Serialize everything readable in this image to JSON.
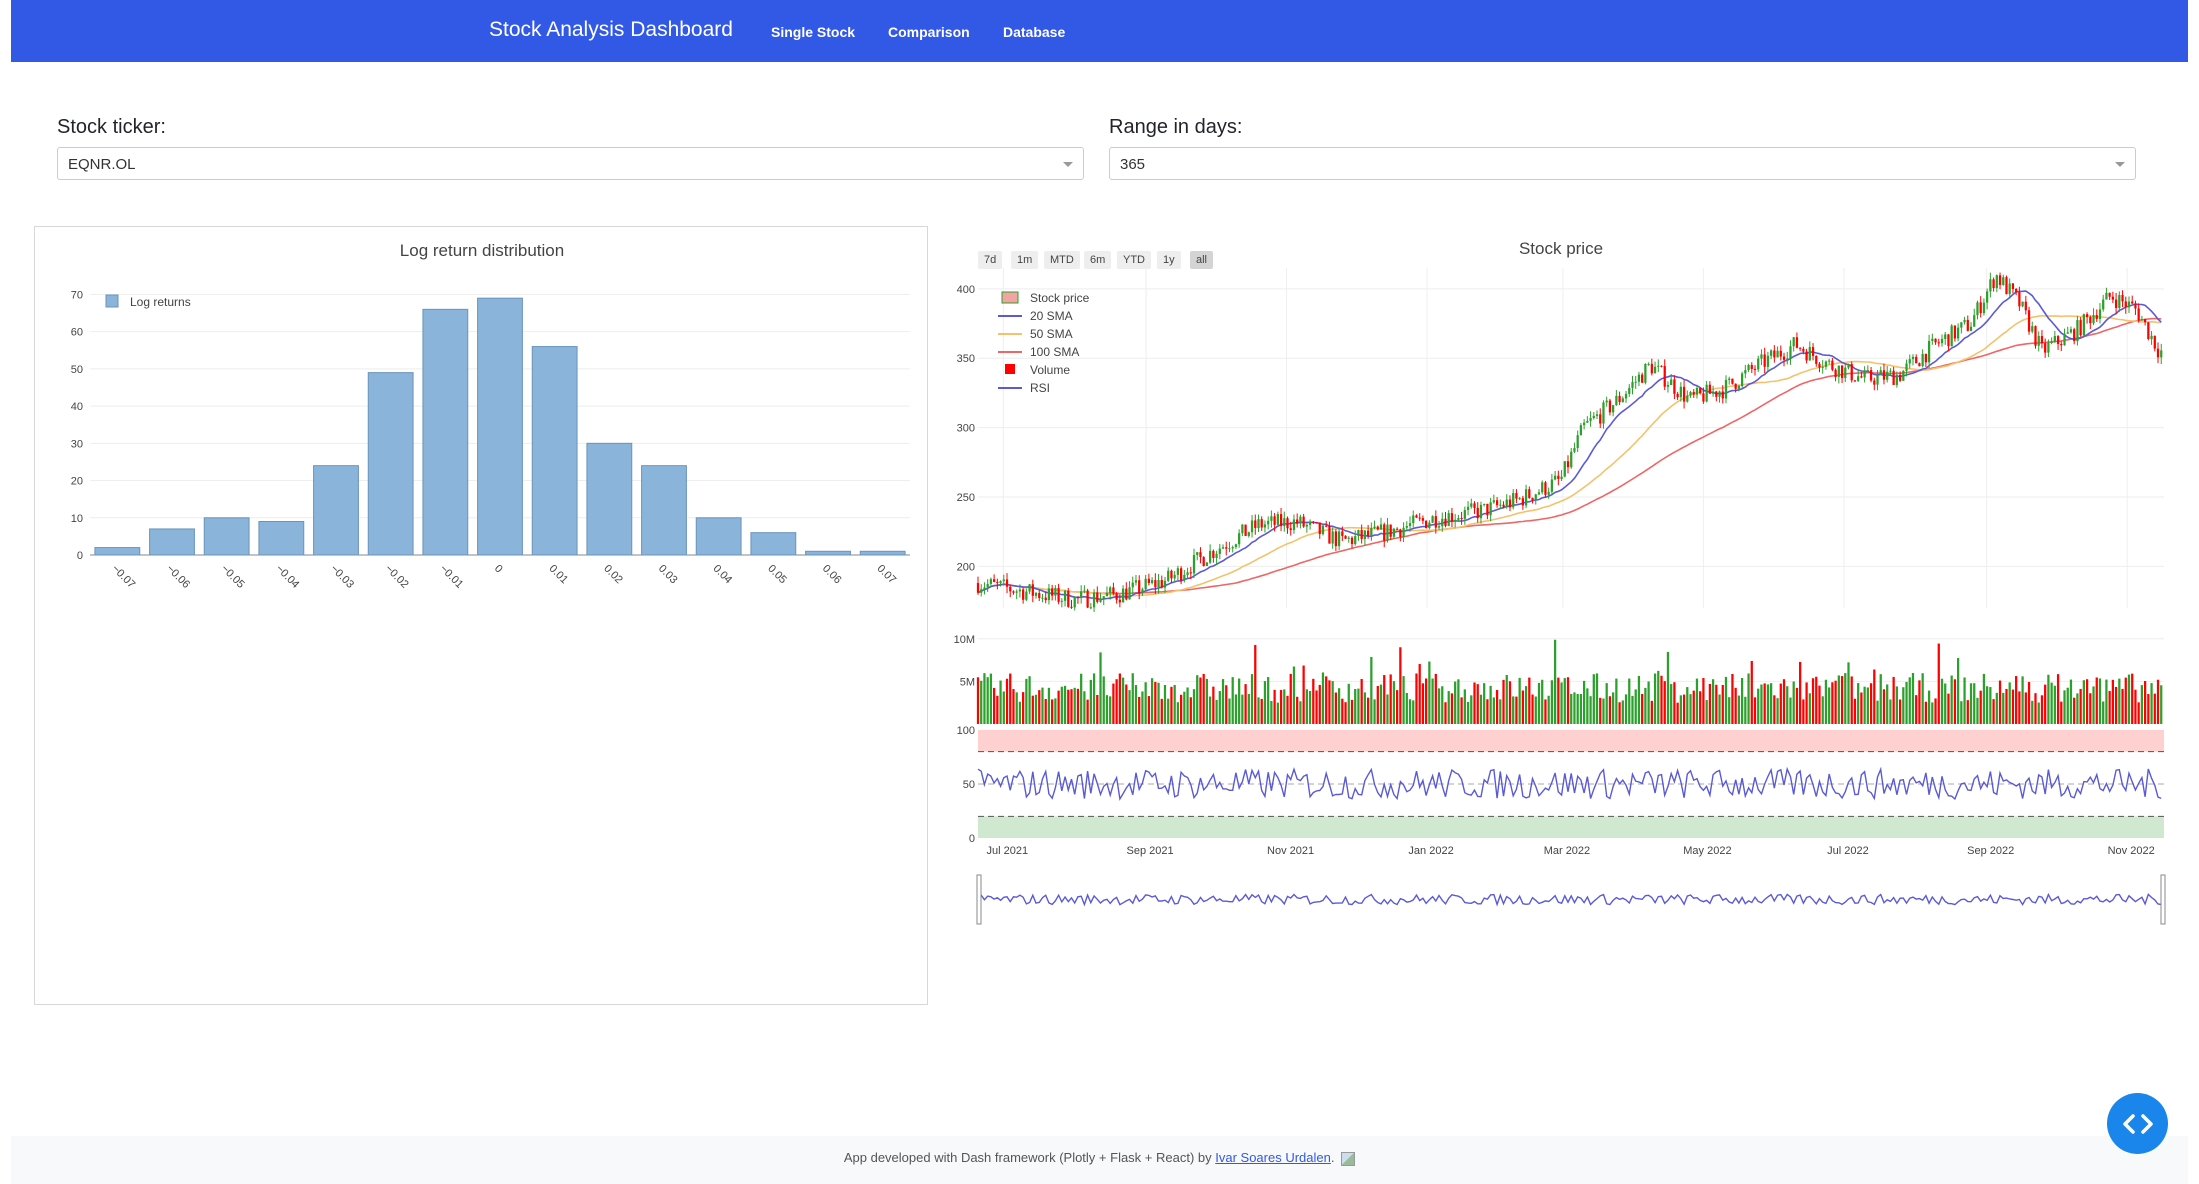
{
  "navbar": {
    "brand": "Stock Analysis Dashboard",
    "links": [
      "Single Stock",
      "Comparison",
      "Database"
    ]
  },
  "controls": {
    "ticker_label": "Stock ticker:",
    "ticker_value": "EQNR.OL",
    "range_label": "Range in days:",
    "range_value": "365"
  },
  "range_selector": [
    "7d",
    "1m",
    "MTD",
    "6m",
    "YTD",
    "1y",
    "all"
  ],
  "range_selector_active": "all",
  "footer": {
    "text_prefix": "App developed with Dash framework (Plotly + Flask + React) by ",
    "author_link": "Ivar Soares Urdalen",
    "text_suffix": "."
  },
  "colors": {
    "navbar": "#3258e6",
    "bar_fill": "#8ab4da",
    "increasing": "#2ca02c",
    "decreasing": "#ff0000",
    "sma20": "#5a5ad6",
    "sma50": "#f5c26b",
    "sma100": "#ee6666",
    "rsi": "#5a5ad6"
  },
  "chart_data": [
    {
      "type": "bar",
      "title": "Log return distribution",
      "legend": [
        "Log returns"
      ],
      "x": [
        -0.07,
        -0.06,
        -0.05,
        -0.04,
        -0.03,
        -0.02,
        -0.01,
        0,
        0.01,
        0.02,
        0.03,
        0.04,
        0.05,
        0.06,
        0.07
      ],
      "x_tick_labels": [
        "−0.07",
        "−0.06",
        "−0.05",
        "−0.04",
        "−0.03",
        "−0.02",
        "−0.01",
        "0",
        "0.01",
        "0.02",
        "0.03",
        "0.04",
        "0.05",
        "0.06",
        "0.07"
      ],
      "values": [
        2,
        7,
        10,
        9,
        24,
        49,
        66,
        69,
        56,
        30,
        24,
        10,
        6,
        1,
        1
      ],
      "y_ticks": [
        0,
        10,
        20,
        30,
        40,
        50,
        60,
        70
      ],
      "ylim": [
        0,
        72
      ],
      "grid": true,
      "legend_position": "top-left"
    },
    {
      "type": "line",
      "title": "Stock price",
      "legend": [
        "Stock price",
        "20 SMA",
        "50 SMA",
        "100 SMA",
        "Volume",
        "RSI"
      ],
      "x_ticks": [
        "Jul 2021",
        "Sep 2021",
        "Nov 2021",
        "Jan 2022",
        "Mar 2022",
        "May 2022",
        "Jul 2022",
        "Sep 2022",
        "Nov 2022"
      ],
      "price_y_ticks": [
        200,
        250,
        300,
        350,
        400
      ],
      "price_ylim": [
        170,
        415
      ],
      "price_anchors": [
        [
          "2021-06-20",
          188
        ],
        [
          "2021-07-10",
          182
        ],
        [
          "2021-08-01",
          176
        ],
        [
          "2021-08-20",
          180
        ],
        [
          "2021-09-10",
          190
        ],
        [
          "2021-10-01",
          212
        ],
        [
          "2021-10-20",
          230
        ],
        [
          "2021-11-05",
          232
        ],
        [
          "2021-11-25",
          218
        ],
        [
          "2021-12-15",
          225
        ],
        [
          "2022-01-05",
          235
        ],
        [
          "2022-01-25",
          240
        ],
        [
          "2022-02-10",
          248
        ],
        [
          "2022-02-28",
          262
        ],
        [
          "2022-03-10",
          300
        ],
        [
          "2022-03-25",
          320
        ],
        [
          "2022-04-08",
          345
        ],
        [
          "2022-04-25",
          320
        ],
        [
          "2022-05-10",
          328
        ],
        [
          "2022-05-25",
          345
        ],
        [
          "2022-06-10",
          360
        ],
        [
          "2022-06-25",
          345
        ],
        [
          "2022-07-10",
          335
        ],
        [
          "2022-07-25",
          338
        ],
        [
          "2022-08-10",
          360
        ],
        [
          "2022-08-25",
          375
        ],
        [
          "2022-09-05",
          410
        ],
        [
          "2022-09-15",
          390
        ],
        [
          "2022-09-25",
          355
        ],
        [
          "2022-10-10",
          370
        ],
        [
          "2022-10-25",
          395
        ],
        [
          "2022-11-05",
          385
        ],
        [
          "2022-11-15",
          355
        ]
      ],
      "volume_y_ticks": [
        "5M",
        "10M"
      ],
      "volume_ylim": [
        0,
        11500000
      ],
      "rsi_y_ticks": [
        0,
        50,
        100
      ],
      "rsi_bands": {
        "overbought": 80,
        "oversold": 20
      },
      "grid": true,
      "legend_position": "top-left"
    }
  ]
}
